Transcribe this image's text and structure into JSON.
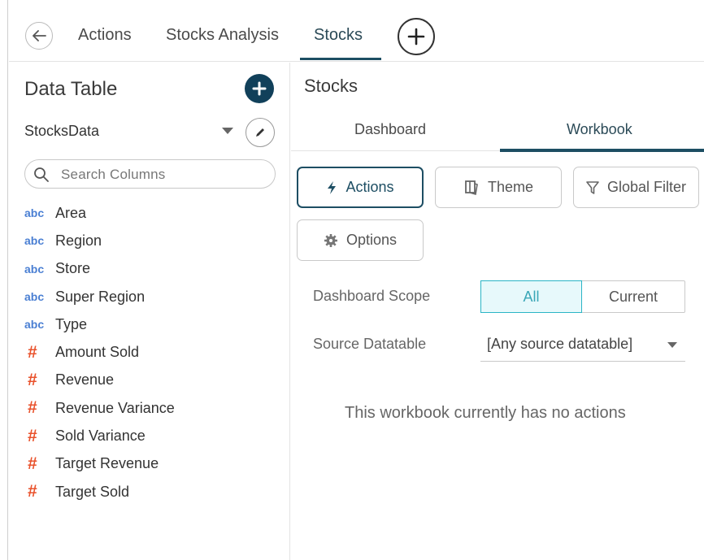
{
  "tabs": {
    "items": [
      {
        "label": "Actions"
      },
      {
        "label": "Stocks Analysis"
      },
      {
        "label": "Stocks",
        "active": true
      }
    ]
  },
  "left_panel": {
    "title": "Data Table",
    "dataset": "StocksData",
    "search": {
      "placeholder": "Search Columns"
    },
    "columns": [
      {
        "type": "abc",
        "label": "Area"
      },
      {
        "type": "abc",
        "label": "Region"
      },
      {
        "type": "abc",
        "label": "Store"
      },
      {
        "type": "abc",
        "label": "Super Region"
      },
      {
        "type": "abc",
        "label": "Type"
      },
      {
        "type": "#",
        "label": "Amount Sold"
      },
      {
        "type": "#",
        "label": "Revenue"
      },
      {
        "type": "#",
        "label": "Revenue Variance"
      },
      {
        "type": "#",
        "label": "Sold Variance"
      },
      {
        "type": "#",
        "label": "Target Revenue"
      },
      {
        "type": "#",
        "label": "Target Sold"
      }
    ]
  },
  "right_panel": {
    "title": "Stocks",
    "subtabs": [
      {
        "label": "Dashboard"
      },
      {
        "label": "Workbook",
        "active": true
      }
    ],
    "buttons": {
      "actions": "Actions",
      "theme": "Theme",
      "global_filter": "Global Filter",
      "options": "Options"
    },
    "dashboard_scope": {
      "label": "Dashboard Scope",
      "options": [
        "All",
        "Current"
      ],
      "selected": "All"
    },
    "source_datatable": {
      "label": "Source Datatable",
      "value": "[Any source datatable]"
    },
    "empty_message": "This workbook currently has no actions"
  },
  "colors": {
    "accent": "#1d4e63",
    "number_type": "#e9522c",
    "text_type": "#4a7fd3",
    "selected_segment": "#2bb5c6"
  }
}
